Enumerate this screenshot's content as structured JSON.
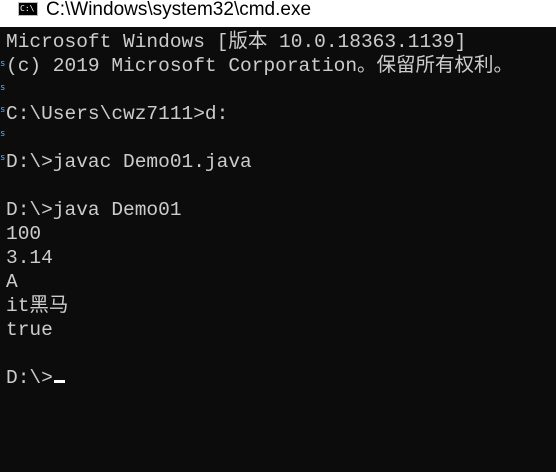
{
  "window": {
    "title": "C:\\Windows\\system32\\cmd.exe",
    "icon_label": "C:\\"
  },
  "console": {
    "lines": [
      "Microsoft Windows [版本 10.0.18363.1139]",
      "(c) 2019 Microsoft Corporation。保留所有权利。",
      "",
      "C:\\Users\\cwz7111>d:",
      "",
      "D:\\>javac Demo01.java",
      "",
      "D:\\>java Demo01",
      "100",
      "3.14",
      "A",
      "it黑马",
      "true",
      "",
      "D:\\>"
    ],
    "gutter_marks": [
      "s",
      "s",
      "s",
      "s",
      "s"
    ]
  },
  "colors": {
    "background": "#0c0c0c",
    "text": "#cccccc",
    "titlebar": "#ffffff",
    "cursor": "#ffffff"
  }
}
